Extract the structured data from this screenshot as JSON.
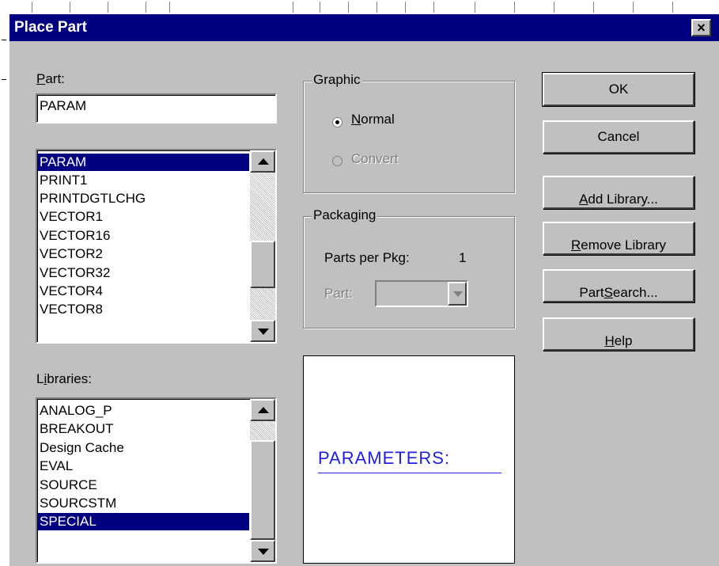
{
  "dialog": {
    "title": "Place Part",
    "close_glyph": "×"
  },
  "part": {
    "label_prefix": "",
    "label_access": "P",
    "label_rest": "art:",
    "value": "PARAM"
  },
  "part_list": {
    "items": [
      "PARAM",
      "PRINT1",
      "PRINTDGTLCHG",
      "VECTOR1",
      "VECTOR16",
      "VECTOR2",
      "VECTOR32",
      "VECTOR4",
      "VECTOR8"
    ],
    "selected": "PARAM"
  },
  "libraries": {
    "label_prefix": "L",
    "label_access": "i",
    "label_rest": "braries:",
    "items": [
      "ANALOG_P",
      "BREAKOUT",
      "Design Cache",
      "EVAL",
      "SOURCE",
      "SOURCSTM",
      "SPECIAL"
    ],
    "selected": "SPECIAL"
  },
  "graphic": {
    "title": "Graphic",
    "normal_access": "N",
    "normal_rest": "ormal",
    "convert_label": "Convert",
    "selected": "Normal"
  },
  "packaging": {
    "title": "Packaging",
    "parts_per_pkg_label": "Parts per Pkg:",
    "parts_per_pkg_value": "1",
    "part_label": "Part:",
    "part_value": ""
  },
  "preview": {
    "text": "PARAMETERS:",
    "color": "#2020e0"
  },
  "buttons": {
    "ok": "OK",
    "cancel": "Cancel",
    "add_library_access": "A",
    "add_library_rest": "dd Library...",
    "remove_library_access": "R",
    "remove_library_rest": "emove Library",
    "part_search_prefix": "Part ",
    "part_search_access": "S",
    "part_search_rest": "earch...",
    "help_access": "H",
    "help_rest": "elp"
  },
  "colors": {
    "titlebar": "#000080",
    "face": "#c0c0c0",
    "selection": "#000080"
  }
}
